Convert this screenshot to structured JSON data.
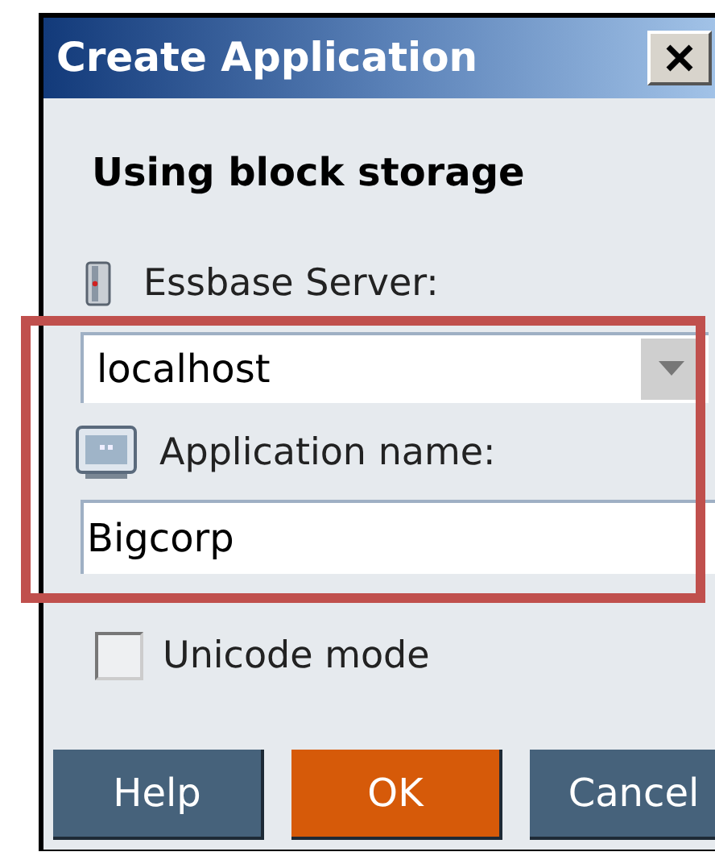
{
  "window": {
    "title": "Create Application"
  },
  "heading": "Using block storage",
  "server": {
    "label": "Essbase Server:",
    "value": "localhost"
  },
  "application": {
    "label": "Application name:",
    "value": "Bigcorp"
  },
  "unicode_mode": {
    "label": "Unicode mode",
    "checked": false
  },
  "buttons": [
    {
      "label": "Help",
      "kind": "secondary"
    },
    {
      "label": "OK",
      "kind": "primary"
    },
    {
      "label": "Cancel",
      "kind": "secondary"
    }
  ]
}
